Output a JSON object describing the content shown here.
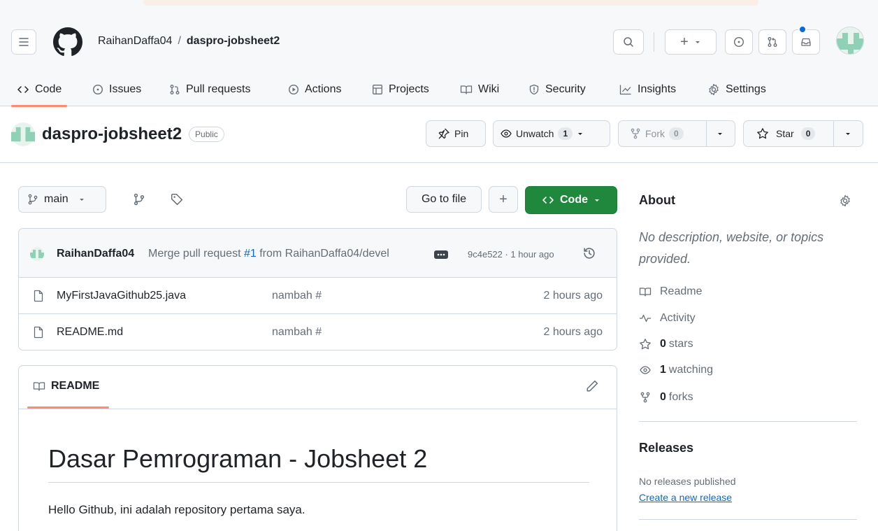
{
  "breadcrumb": {
    "owner": "RaihanDaffa04",
    "separator": "/",
    "repo": "daspro-jobsheet2"
  },
  "header": {
    "new_label": "+"
  },
  "tabs": [
    {
      "label": "Code",
      "icon": "code-icon"
    },
    {
      "label": "Issues",
      "icon": "issue-icon"
    },
    {
      "label": "Pull requests",
      "icon": "pull-request-icon"
    },
    {
      "label": "Actions",
      "icon": "play-icon"
    },
    {
      "label": "Projects",
      "icon": "table-icon"
    },
    {
      "label": "Wiki",
      "icon": "book-icon"
    },
    {
      "label": "Security",
      "icon": "shield-icon"
    },
    {
      "label": "Insights",
      "icon": "graph-icon"
    },
    {
      "label": "Settings",
      "icon": "gear-icon"
    }
  ],
  "repo": {
    "name": "daspro-jobsheet2",
    "visibility": "Public",
    "pin_label": "Pin",
    "unwatch_label": "Unwatch",
    "watch_count": "1",
    "fork_label": "Fork",
    "fork_count": "0",
    "star_label": "Star",
    "star_count": "0"
  },
  "branch_bar": {
    "branch": "main",
    "go_to_file": "Go to file",
    "add_label": "+",
    "code_label": "Code"
  },
  "commit": {
    "author": "RaihanDaffa04",
    "message_prefix": "Merge pull request",
    "pr_link": "#1",
    "message_suffix": "from RaihanDaffa04/devel",
    "hash_time": "9c4e522 · 1 hour ago"
  },
  "files": [
    {
      "name": "MyFirstJavaGithub25.java",
      "message": "nambah #",
      "time": "2 hours ago"
    },
    {
      "name": "README.md",
      "message": "nambah #",
      "time": "2 hours ago"
    }
  ],
  "readme": {
    "tab_label": "README",
    "heading": "Dasar Pemrograman - Jobsheet 2",
    "body": "Hello Github, ini adalah repository pertama saya."
  },
  "about": {
    "title": "About",
    "description": "No description, website, or topics provided.",
    "readme": "Readme",
    "activity": "Activity",
    "stars_count": "0",
    "stars_label": "stars",
    "watching_count": "1",
    "watching_label": "watching",
    "forks_count": "0",
    "forks_label": "forks"
  },
  "releases": {
    "title": "Releases",
    "none": "No releases published",
    "create_link": "Create a new release"
  },
  "colors": {
    "accent_green": "#1f883d",
    "link_blue": "#0969da",
    "tab_underline": "#fd8c73",
    "notification_blue": "#0969da"
  }
}
